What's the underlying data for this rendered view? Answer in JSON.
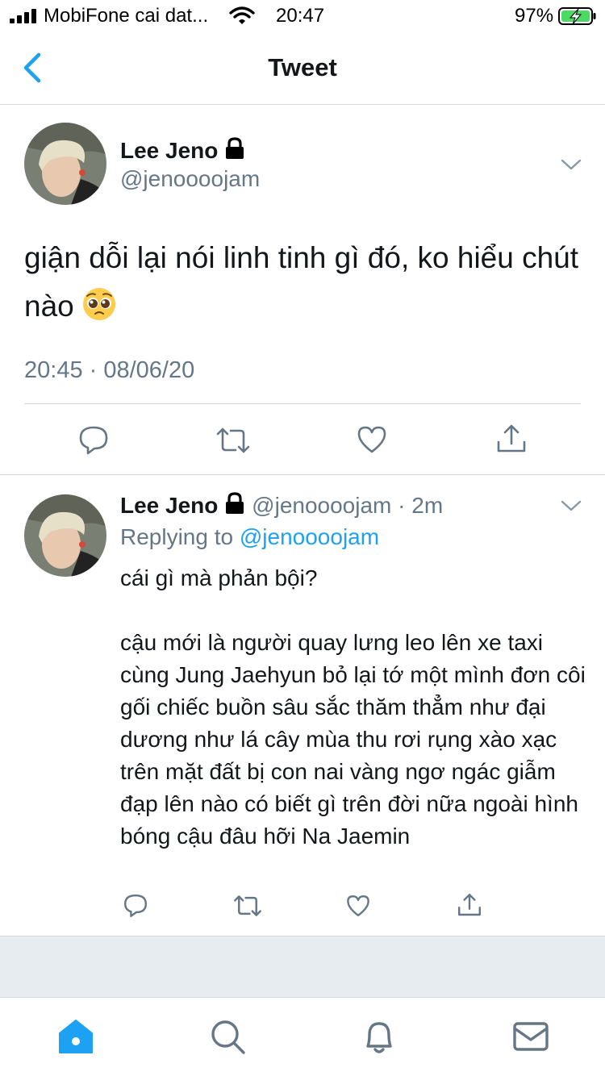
{
  "status_bar": {
    "carrier": "MobiFone cai dat...",
    "time": "20:47",
    "battery_percent": "97%"
  },
  "nav": {
    "title": "Tweet",
    "back_icon": "chevron-left-icon"
  },
  "main_tweet": {
    "display_name": "Lee Jeno",
    "protected": true,
    "handle": "@jenoooojam",
    "text": "giận dỗi lại nói linh tinh gì đó, ko hiểu chút nào",
    "emoji": "pleading-face-emoji",
    "timestamp": "20:45 · 08/06/20"
  },
  "reply_tweet": {
    "display_name": "Lee Jeno",
    "protected": true,
    "handle": "@jenoooojam",
    "separator": "·",
    "age": "2m",
    "replying_prefix": "Replying to ",
    "replying_to": "@jenoooojam",
    "paragraph1": "cái gì mà phản bội?",
    "paragraph2": "cậu mới là người quay lưng leo lên xe taxi cùng Jung Jaehyun bỏ lại tớ một mình đơn côi gối chiếc buồn sâu sắc thăm thẳm như đại dương như lá cây mùa thu rơi rụng xào xạc trên mặt đất bị con nai vàng ngơ ngác giẫm đạp lên nào có biết gì trên đời nữa ngoài hình bóng cậu đâu hỡi Na Jaemin"
  },
  "actions": [
    "reply-icon",
    "retweet-icon",
    "like-icon",
    "share-icon"
  ],
  "tab_bar": {
    "tabs": [
      "home-icon",
      "search-icon",
      "notifications-icon",
      "messages-icon"
    ],
    "active": "home-icon"
  },
  "colors": {
    "accent": "#1da1f2",
    "secondary_text": "#657786",
    "divider": "#d5d9dd",
    "background_band": "#e6ecf0",
    "battery_green": "#4cd964"
  }
}
